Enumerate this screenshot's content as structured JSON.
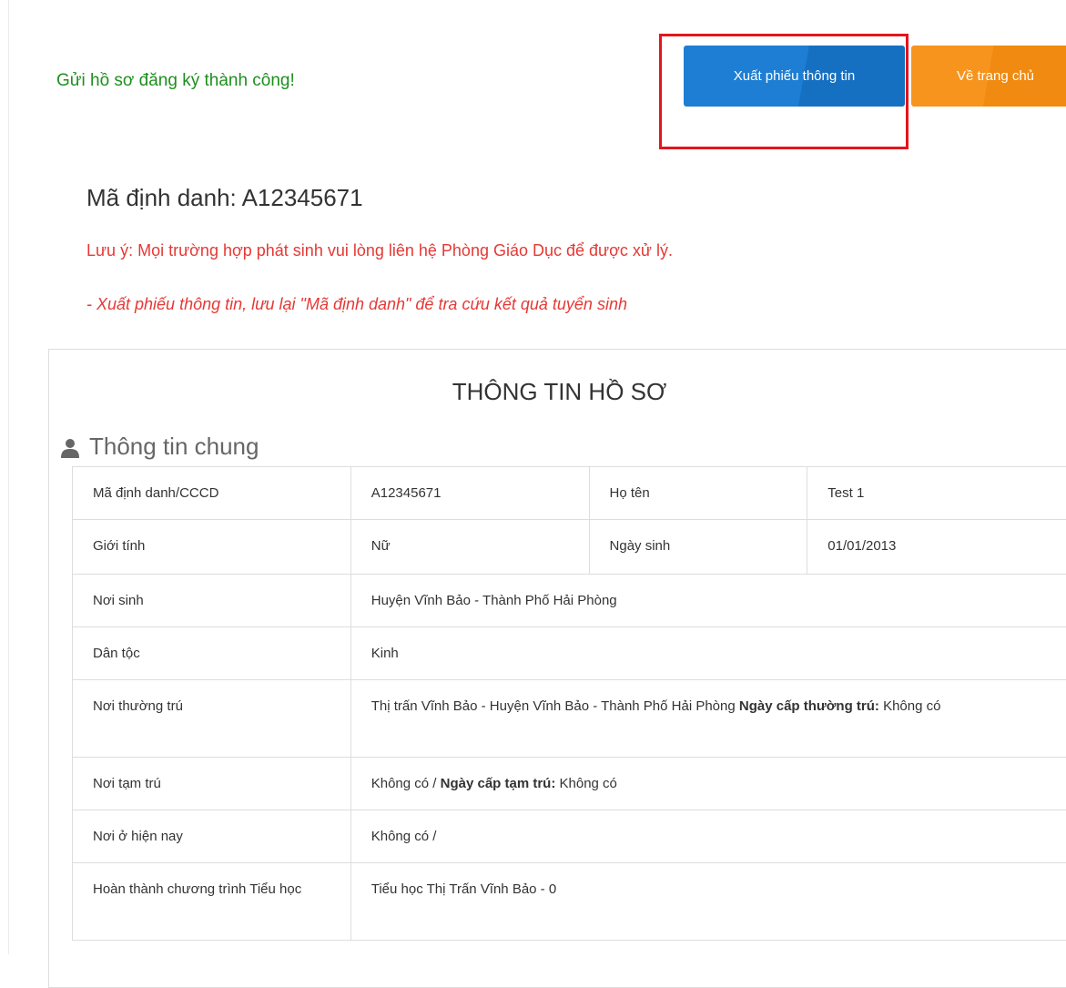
{
  "success_message": "Gửi hồ sơ đăng ký thành công!",
  "buttons": {
    "export": "Xuất phiếu thông tin",
    "home": "Về trang chủ"
  },
  "identifier_heading": "Mã định danh: A12345671",
  "notes": {
    "line1": "Lưu ý: Mọi trường hợp phát sinh vui lòng liên hệ Phòng Giáo Dục để được xử lý.",
    "line2": "- Xuất phiếu thông tin, lưu lại \"Mã định danh\" để tra cứu kết quả tuyển sinh"
  },
  "card": {
    "title": "THÔNG TIN HỒ SƠ",
    "section_title": "Thông tin chung",
    "section_icon": "user-icon"
  },
  "table": {
    "id_label": "Mã định danh/CCCD",
    "id_value": "A12345671",
    "name_label": "Họ tên",
    "name_value": "Test 1",
    "gender_label": "Giới tính",
    "gender_value": "Nữ",
    "dob_label": "Ngày sinh",
    "dob_value": "01/01/2013",
    "birthplace_label": "Nơi sinh",
    "birthplace_value": "Huyện Vĩnh Bảo - Thành Phố Hải Phòng",
    "ethnicity_label": "Dân tộc",
    "ethnicity_value": "Kinh",
    "permanent_label": "Nơi thường trú",
    "permanent_address": "Thị trấn Vĩnh Bảo - Huyện Vĩnh Bảo - Thành Phố Hải Phòng",
    "permanent_date_label": "Ngày cấp thường trú:",
    "permanent_date_value": "Không có",
    "temporary_label": "Nơi tạm trú",
    "temporary_address": "Không có /",
    "temporary_date_label": "Ngày cấp tạm trú:",
    "temporary_date_value": "Không có",
    "current_label": "Nơi ở hiện nay",
    "current_value": "Không có /",
    "primary_label": "Hoàn thành chương trình Tiểu học",
    "primary_value": "Tiểu học Thị Trấn Vĩnh Bảo - 0"
  },
  "colors": {
    "success": "#1e8f1e",
    "export_button": "#1e7ed3",
    "home_button": "#f7941d",
    "note": "#e53935",
    "highlight": "#e3161c"
  }
}
